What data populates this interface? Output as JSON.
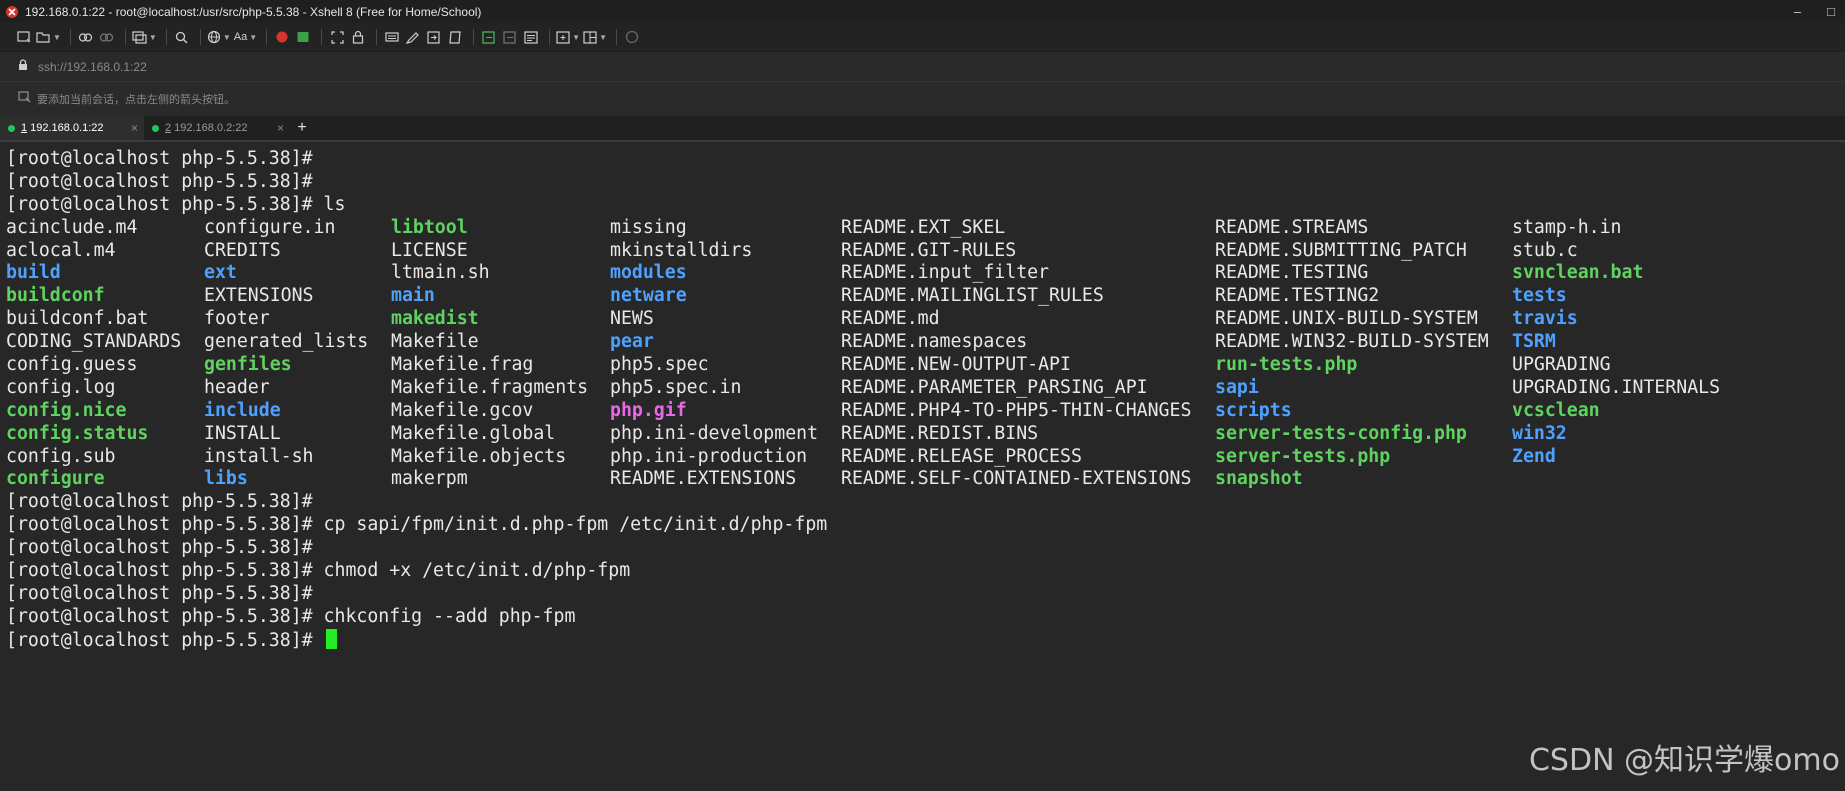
{
  "window": {
    "title": "192.168.0.1:22 - root@localhost:/usr/src/php-5.5.38 - Xshell 8 (Free for Home/School)",
    "minimize_icon": "minimize-icon",
    "maximize_icon": "maximize-icon"
  },
  "address": {
    "text": "ssh://192.168.0.1:22"
  },
  "info": {
    "hint": "要添加当前会话，点击左侧的箭头按钮。"
  },
  "tabs": [
    {
      "num": "1",
      "label": "192.168.0.1:22",
      "close": "×",
      "status_color": "#22c55e"
    },
    {
      "num": "2",
      "label": "192.168.0.2:22",
      "close": "×",
      "status_color": "#22c55e"
    }
  ],
  "tab_add": "+",
  "terminal": {
    "lines_before": [
      "[root@localhost php-5.5.38]#",
      "[root@localhost php-5.5.38]#",
      "[root@localhost php-5.5.38]# ls"
    ],
    "ls_rows": [
      [
        {
          "t": "acinclude.m4",
          "c": "file"
        },
        {
          "t": "configure.in",
          "c": "file"
        },
        {
          "t": "libtool",
          "c": "exe"
        },
        {
          "t": "missing",
          "c": "file"
        },
        {
          "t": "README.EXT_SKEL",
          "c": "file"
        },
        {
          "t": "README.STREAMS",
          "c": "file"
        },
        {
          "t": "stamp-h.in",
          "c": "file"
        }
      ],
      [
        {
          "t": "aclocal.m4",
          "c": "file"
        },
        {
          "t": "CREDITS",
          "c": "file"
        },
        {
          "t": "LICENSE",
          "c": "file"
        },
        {
          "t": "mkinstalldirs",
          "c": "file"
        },
        {
          "t": "README.GIT-RULES",
          "c": "file"
        },
        {
          "t": "README.SUBMITTING_PATCH",
          "c": "file"
        },
        {
          "t": "stub.c",
          "c": "file"
        }
      ],
      [
        {
          "t": "build",
          "c": "dir"
        },
        {
          "t": "ext",
          "c": "dir"
        },
        {
          "t": "ltmain.sh",
          "c": "file"
        },
        {
          "t": "modules",
          "c": "dir"
        },
        {
          "t": "README.input_filter",
          "c": "file"
        },
        {
          "t": "README.TESTING",
          "c": "file"
        },
        {
          "t": "svnclean.bat",
          "c": "exe"
        }
      ],
      [
        {
          "t": "buildconf",
          "c": "exe"
        },
        {
          "t": "EXTENSIONS",
          "c": "file"
        },
        {
          "t": "main",
          "c": "dir"
        },
        {
          "t": "netware",
          "c": "dir"
        },
        {
          "t": "README.MAILINGLIST_RULES",
          "c": "file"
        },
        {
          "t": "README.TESTING2",
          "c": "file"
        },
        {
          "t": "tests",
          "c": "dir"
        }
      ],
      [
        {
          "t": "buildconf.bat",
          "c": "file"
        },
        {
          "t": "footer",
          "c": "file"
        },
        {
          "t": "makedist",
          "c": "exe"
        },
        {
          "t": "NEWS",
          "c": "file"
        },
        {
          "t": "README.md",
          "c": "file"
        },
        {
          "t": "README.UNIX-BUILD-SYSTEM",
          "c": "file"
        },
        {
          "t": "travis",
          "c": "dir"
        }
      ],
      [
        {
          "t": "CODING_STANDARDS",
          "c": "file"
        },
        {
          "t": "generated_lists",
          "c": "file"
        },
        {
          "t": "Makefile",
          "c": "file"
        },
        {
          "t": "pear",
          "c": "dir"
        },
        {
          "t": "README.namespaces",
          "c": "file"
        },
        {
          "t": "README.WIN32-BUILD-SYSTEM",
          "c": "file"
        },
        {
          "t": "TSRM",
          "c": "dir"
        }
      ],
      [
        {
          "t": "config.guess",
          "c": "file"
        },
        {
          "t": "genfiles",
          "c": "exe"
        },
        {
          "t": "Makefile.frag",
          "c": "file"
        },
        {
          "t": "php5.spec",
          "c": "file"
        },
        {
          "t": "README.NEW-OUTPUT-API",
          "c": "file"
        },
        {
          "t": "run-tests.php",
          "c": "exe"
        },
        {
          "t": "UPGRADING",
          "c": "file"
        }
      ],
      [
        {
          "t": "config.log",
          "c": "file"
        },
        {
          "t": "header",
          "c": "file"
        },
        {
          "t": "Makefile.fragments",
          "c": "file"
        },
        {
          "t": "php5.spec.in",
          "c": "file"
        },
        {
          "t": "README.PARAMETER_PARSING_API",
          "c": "file"
        },
        {
          "t": "sapi",
          "c": "dir"
        },
        {
          "t": "UPGRADING.INTERNALS",
          "c": "file"
        }
      ],
      [
        {
          "t": "config.nice",
          "c": "exe"
        },
        {
          "t": "include",
          "c": "dir"
        },
        {
          "t": "Makefile.gcov",
          "c": "file"
        },
        {
          "t": "php.gif",
          "c": "img"
        },
        {
          "t": "README.PHP4-TO-PHP5-THIN-CHANGES",
          "c": "file"
        },
        {
          "t": "scripts",
          "c": "dir"
        },
        {
          "t": "vcsclean",
          "c": "exe"
        }
      ],
      [
        {
          "t": "config.status",
          "c": "exe"
        },
        {
          "t": "INSTALL",
          "c": "file"
        },
        {
          "t": "Makefile.global",
          "c": "file"
        },
        {
          "t": "php.ini-development",
          "c": "file"
        },
        {
          "t": "README.REDIST.BINS",
          "c": "file"
        },
        {
          "t": "server-tests-config.php",
          "c": "exe"
        },
        {
          "t": "win32",
          "c": "dir"
        }
      ],
      [
        {
          "t": "config.sub",
          "c": "file"
        },
        {
          "t": "install-sh",
          "c": "file"
        },
        {
          "t": "Makefile.objects",
          "c": "file"
        },
        {
          "t": "php.ini-production",
          "c": "file"
        },
        {
          "t": "README.RELEASE_PROCESS",
          "c": "file"
        },
        {
          "t": "server-tests.php",
          "c": "exe"
        },
        {
          "t": "Zend",
          "c": "dir"
        }
      ],
      [
        {
          "t": "configure",
          "c": "exe"
        },
        {
          "t": "libs",
          "c": "dir"
        },
        {
          "t": "makerpm",
          "c": "file"
        },
        {
          "t": "README.EXTENSIONS",
          "c": "file"
        },
        {
          "t": "README.SELF-CONTAINED-EXTENSIONS",
          "c": "file"
        },
        {
          "t": "snapshot",
          "c": "exe"
        },
        {
          "t": "",
          "c": "file"
        }
      ]
    ],
    "lines_after": [
      "[root@localhost php-5.5.38]#",
      "[root@localhost php-5.5.38]# cp sapi/fpm/init.d.php-fpm /etc/init.d/php-fpm",
      "[root@localhost php-5.5.38]#",
      "[root@localhost php-5.5.38]# chmod +x /etc/init.d/php-fpm",
      "[root@localhost php-5.5.38]#",
      "[root@localhost php-5.5.38]# chkconfig --add php-fpm",
      "[root@localhost php-5.5.38]# "
    ],
    "cursor_color": "#22ee22"
  },
  "watermark": "CSDN @知识学爆omo"
}
